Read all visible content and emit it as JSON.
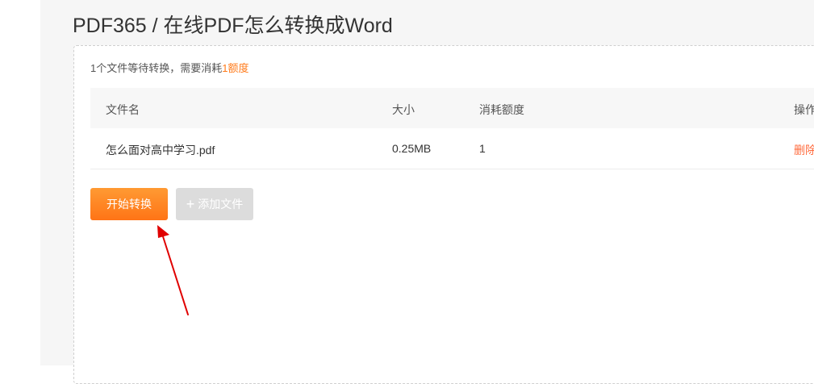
{
  "page": {
    "title": "PDF365 / 在线PDF怎么转换成Word"
  },
  "summary": {
    "prefix": "1个文件等待转换，需要消耗",
    "amount": "1额度"
  },
  "table": {
    "headers": {
      "name": "文件名",
      "size": "大小",
      "credits": "消耗额度",
      "action": "操作"
    },
    "rows": [
      {
        "name": "怎么面对高中学习.pdf",
        "size": "0.25MB",
        "credits": "1",
        "action": "删除"
      }
    ]
  },
  "buttons": {
    "start": "开始转换",
    "add_icon": "+",
    "add": "添加文件"
  },
  "colors": {
    "accent": "#ff7a1a",
    "arrow": "#e00000",
    "disabled": "#dcdcdc"
  },
  "icons": {
    "add": "plus-icon",
    "annotation": "red-arrow-icon"
  }
}
